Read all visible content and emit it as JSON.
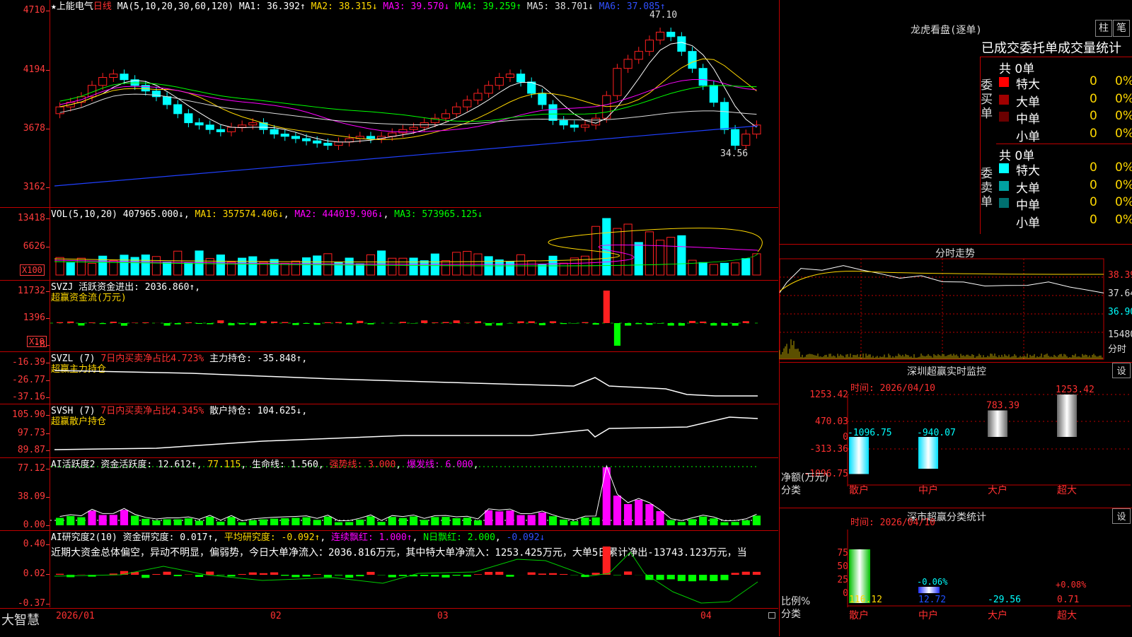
{
  "main": {
    "star_icon": "star-icon",
    "stock_name": "上能电气",
    "period": "日线",
    "ma_header": "MA(5,10,20,30,60,120)",
    "ma1": "MA1: 36.392↑",
    "ma2": "MA2: 38.315↓",
    "ma3": "MA3: 39.570↓",
    "ma4": "MA4: 39.259↑",
    "ma5": "MA5: 38.701↓",
    "ma6": "MA6: 37.085↑",
    "y_ticks": [
      "4710",
      "4194",
      "3678",
      "3162"
    ],
    "high_label": "47.10",
    "low_label": "34.56"
  },
  "vol": {
    "header": "VOL(5,10,20)",
    "value": "407965.000↓",
    "ma1": "MA1: 357574.406↓",
    "ma2": "MA2: 444019.906↓",
    "ma3": "MA3: 573965.125↓",
    "y_ticks": [
      "13418",
      "6626"
    ],
    "unit": "X100"
  },
  "svzj": {
    "header": "SVZJ",
    "line1": "活跃资金进出: 2036.860↑",
    "line2": "超赢资金流(万元)",
    "y_ticks": [
      "11732",
      "1396",
      "-8"
    ],
    "unit": "X10"
  },
  "svzl": {
    "header": "SVZL (7)",
    "pct": "7日内买卖净占比4.723%",
    "hold": "主力持仓: -35.848↑",
    "line2": "超赢主力持仓",
    "y_ticks": [
      "-16.39",
      "-26.77",
      "-37.16"
    ]
  },
  "svsh": {
    "header": "SVSH (7)",
    "pct": "7日内买卖净占比4.345%",
    "hold": "散户持仓: 104.625↓",
    "line2": "超赢散户持仓",
    "y_ticks": [
      "105.90",
      "97.73",
      "89.87"
    ]
  },
  "ai1": {
    "header": "AI活跃度2",
    "act": "资金活跃度: 12.612↑",
    "v2": "77.115",
    "life": "生命线: 1.560",
    "strong": "强势线: 3.000",
    "burst": "爆发线: 6.000",
    "y_ticks": [
      "77.12",
      "38.09",
      "0.00"
    ]
  },
  "ai2": {
    "header": "AI研究度2(10)",
    "res": "资金研究度: 0.017↑",
    "avg": "平均研究度: -0.092↑",
    "red": "连续飘红: 1.000↑",
    "nred": "N日飘红: 2.000",
    "neg": "-0.092↓",
    "comment": "近期大资金总体偏空，异动不明显，偏弱势，今日大单净流入：2036.816万元，其中特大单净流入：1253.425万元，大单5日累计净出-13743.123万元，当",
    "y_ticks": [
      "0.40",
      "0.02",
      "-0.37"
    ]
  },
  "bottom": {
    "brand": "大智慧",
    "dates": [
      "2026/01",
      "02",
      "03",
      "04"
    ]
  },
  "lhb": {
    "title": "龙虎看盘(逐单)",
    "btn_bar": "柱",
    "btn_pen": "笔",
    "subtitle": "已成交委托单成交量统计",
    "buy_label": "委买单",
    "sell_label": "委卖单",
    "buy_total": "共 0单",
    "sell_total": "共 0单",
    "buy_rows": [
      {
        "name": "特大",
        "count": "0",
        "pct": "0%",
        "color": "#ff0000"
      },
      {
        "name": "大单",
        "count": "0",
        "pct": "0%",
        "color": "#a00000"
      },
      {
        "name": "中单",
        "count": "0",
        "pct": "0%",
        "color": "#6a0000"
      },
      {
        "name": "小单",
        "count": "0",
        "pct": "0%",
        "color": ""
      }
    ],
    "sell_rows": [
      {
        "name": "特大",
        "count": "0",
        "pct": "0%",
        "color": "#00ffff"
      },
      {
        "name": "大单",
        "count": "0",
        "pct": "0%",
        "color": "#00a0a0"
      },
      {
        "name": "中单",
        "count": "0",
        "pct": "0%",
        "color": "#007070"
      },
      {
        "name": "小单",
        "count": "0",
        "pct": "0%",
        "color": ""
      }
    ]
  },
  "intraday": {
    "title": "分时走势",
    "prices": [
      "38.39",
      "37.64",
      "36.90"
    ],
    "vol_max": "15480",
    "tag": "分时"
  },
  "monitor": {
    "title": "深圳超赢实时监控",
    "settings_btn": "设",
    "time": "时间: 2026/04/10",
    "y_ticks": [
      "1253.42",
      "470.03",
      "0",
      "-313.36",
      "-1096.75"
    ],
    "ylabel": "净额(万元)",
    "xlabel": "分类",
    "categories": [
      "散户",
      "中户",
      "大户",
      "超大"
    ],
    "values": [
      "-1096.75",
      "-940.07",
      "783.39",
      "1253.42"
    ]
  },
  "classify": {
    "title": "深市超赢分类统计",
    "settings_btn": "设",
    "time": "时间: 2026/04/10",
    "y_ticks": [
      "75",
      "50",
      "25",
      "0"
    ],
    "ylabel": "比例%",
    "xlabel": "分类",
    "categories": [
      "散户",
      "中户",
      "大户",
      "超大"
    ],
    "values": [
      "116.12",
      "12.72",
      "-29.56",
      "0.71"
    ],
    "bar_labels": [
      "",
      "-0.06%",
      "",
      "+0.08%"
    ]
  },
  "colors": {
    "up": "#ff2020",
    "down": "#00ffff",
    "axis": "#c00000",
    "yellow": "#ffd800",
    "magenta": "#ff00ff",
    "green": "#00ff00"
  }
}
